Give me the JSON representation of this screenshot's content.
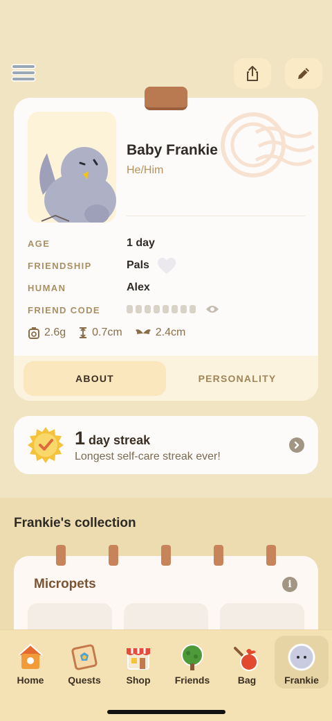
{
  "header": {
    "menu_icon": "hamburger-icon",
    "share_icon": "share-icon",
    "edit_icon": "pencil-icon"
  },
  "profile": {
    "name": "Baby Frankie",
    "pronouns": "He/Him",
    "rows": [
      {
        "label": "AGE",
        "value": "1 day"
      },
      {
        "label": "FRIENDSHIP",
        "value": "Pals"
      },
      {
        "label": "HUMAN",
        "value": "Alex"
      },
      {
        "label": "FRIEND CODE",
        "value": ""
      }
    ],
    "stats": {
      "weight": "2.6g",
      "height": "0.7cm",
      "wingspan": "2.4cm"
    },
    "tabs": {
      "about": "ABOUT",
      "personality": "PERSONALITY"
    }
  },
  "streak": {
    "number": "1",
    "label": "day streak",
    "subtitle": "Longest self-care streak ever!"
  },
  "collection": {
    "title": "Frankie's collection",
    "section": "Micropets",
    "info_icon": "i"
  },
  "nav": {
    "items": [
      {
        "label": "Home",
        "icon": "birdhouse-icon"
      },
      {
        "label": "Quests",
        "icon": "scroll-icon"
      },
      {
        "label": "Shop",
        "icon": "shop-icon"
      },
      {
        "label": "Friends",
        "icon": "tree-icon"
      },
      {
        "label": "Bag",
        "icon": "bag-icon"
      },
      {
        "label": "Frankie",
        "icon": "bird-avatar-icon"
      }
    ],
    "active": "Frankie"
  },
  "colors": {
    "background": "#f0e4c2",
    "card": "#fdfbfa",
    "accent_brown": "#b97a52",
    "label_gold": "#a88f64",
    "bird_gray": "#aeb0c6"
  }
}
